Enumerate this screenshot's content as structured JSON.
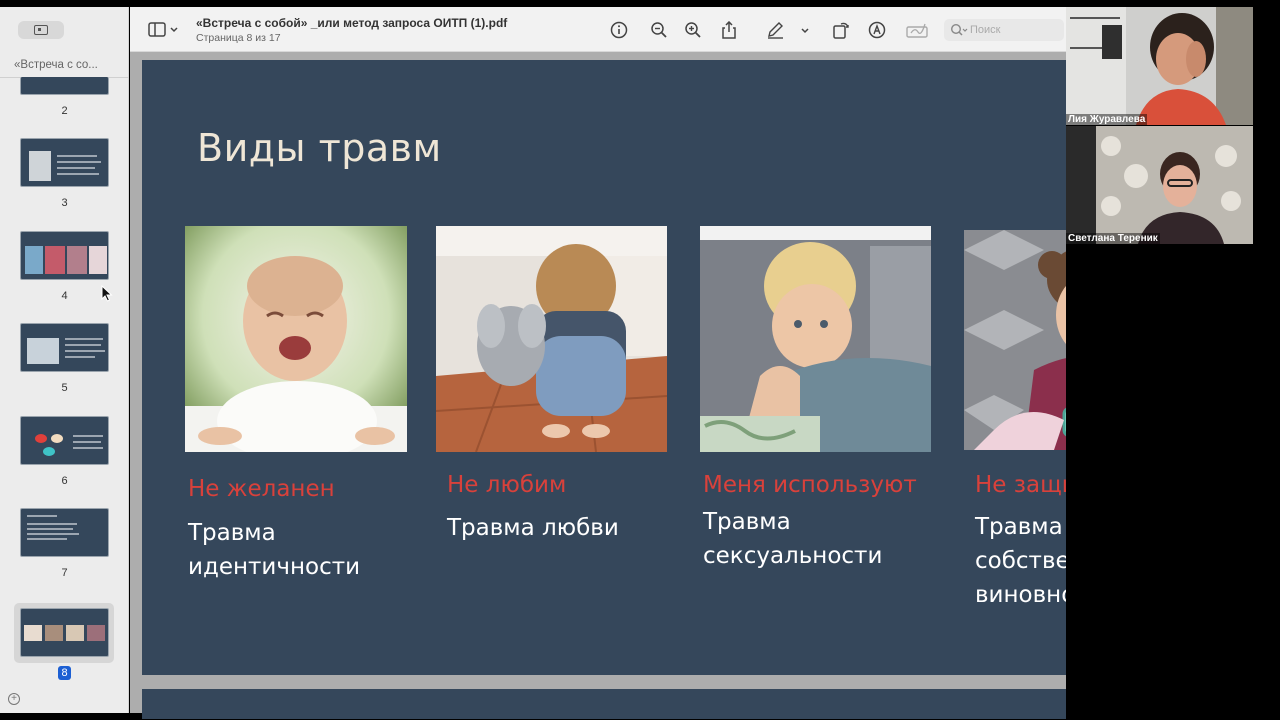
{
  "window": {
    "doc_title": "«Встреча с собой» _или метод запроса ОИТП (1).pdf",
    "page_info": "Страница 8 из 17"
  },
  "sidebar": {
    "title": "«Встреча с со...",
    "thumbnails": [
      {
        "number": "2"
      },
      {
        "number": "3"
      },
      {
        "number": "4"
      },
      {
        "number": "5"
      },
      {
        "number": "6"
      },
      {
        "number": "7"
      },
      {
        "number": "8",
        "selected": true
      }
    ]
  },
  "toolbar": {
    "icons": [
      "sidebar-toggle-icon",
      "info-icon",
      "zoom-out-icon",
      "zoom-in-icon",
      "share-icon",
      "markup-pen-icon",
      "rotate-icon",
      "annotate-icon",
      "signature-icon",
      "search-icon"
    ],
    "search_placeholder": "Поиск"
  },
  "slide": {
    "title": "Виды травм",
    "cards": [
      {
        "red": "Не желанен",
        "white_lines": [
          "Травма",
          "идентичности"
        ],
        "image": "crying-baby"
      },
      {
        "red": "Не любим",
        "white_lines": [
          "Травма любви"
        ],
        "image": "sad-child-with-toy"
      },
      {
        "red": "Меня используют",
        "white_lines": [
          "Травма",
          "сексуальности"
        ],
        "image": "toddler-with-blanket"
      },
      {
        "red": "Не защищен",
        "white_lines": [
          "Травма",
          "собственной",
          "виновности"
        ],
        "image": "screaming-girl"
      }
    ]
  },
  "video": {
    "participants": [
      {
        "name": "Лия Журавлева"
      },
      {
        "name": "Светлана Тереник"
      }
    ]
  },
  "colors": {
    "slide_bg": "#35475b",
    "slide_title": "#efe6d6",
    "accent_red": "#d9413b",
    "selection_blue": "#1c5fd3"
  }
}
